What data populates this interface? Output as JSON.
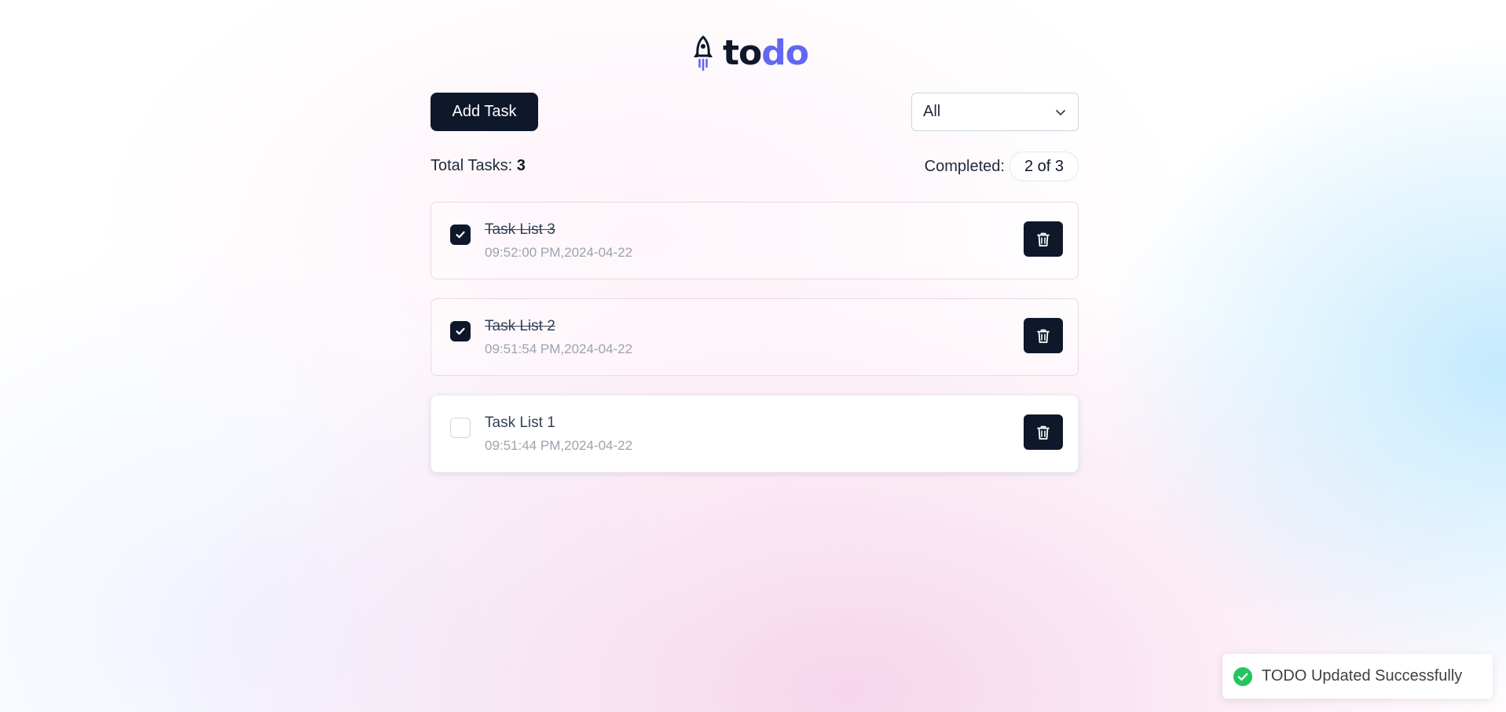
{
  "header": {
    "logo_part1": "to",
    "logo_part2": "do",
    "logo_icon": "rocket-icon"
  },
  "toolbar": {
    "add_label": "Add Task",
    "filter": {
      "selected": "All"
    }
  },
  "summary": {
    "total_label": "Total Tasks:",
    "total_count": "3",
    "completed_label": "Completed:",
    "completed_value": "2 of 3"
  },
  "tasks": [
    {
      "title": "Task List 3",
      "timestamp": "09:52:00 PM,2024-04-22",
      "completed": true
    },
    {
      "title": "Task List 2",
      "timestamp": "09:51:54 PM,2024-04-22",
      "completed": true
    },
    {
      "title": "Task List 1",
      "timestamp": "09:51:44 PM,2024-04-22",
      "completed": false
    }
  ],
  "toast": {
    "message": "TODO Updated Successfully",
    "icon": "check-circle-icon"
  },
  "colors": {
    "primary": "#0f172a",
    "accent": "#6366f1",
    "success": "#22c55e"
  }
}
